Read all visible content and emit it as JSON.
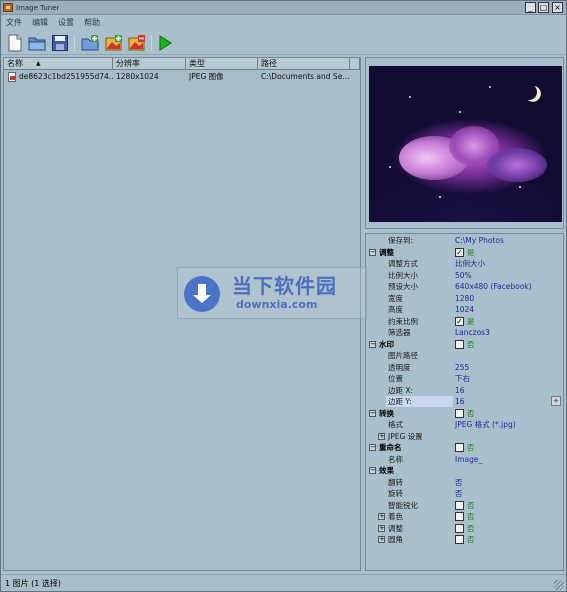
{
  "window": {
    "title": "Image Tuner",
    "controls": {
      "minimize": "_",
      "maximize": "□",
      "close": "×"
    }
  },
  "menu": [
    "文件",
    "编辑",
    "设置",
    "帮助"
  ],
  "toolbar": {
    "buttons": [
      "new-file-icon",
      "open-folder-icon",
      "save-icon",
      "add-folder-icon",
      "add-image-icon",
      "remove-image-icon",
      "run-icon"
    ]
  },
  "filelist": {
    "columns": [
      "名称",
      "分辨率",
      "类型",
      "路径"
    ],
    "sort_indicator": "▲",
    "rows": [
      {
        "name": "de8623c1bd251955d74...",
        "resolution": "1280x1024",
        "type": "JPEG 图像",
        "path": "C:\\Documents and Se..."
      }
    ]
  },
  "properties": {
    "save_to": {
      "label": "保存到:",
      "value": "C:\\My Photos"
    },
    "adjust": {
      "label": "调整",
      "checked": true,
      "check_text": "是",
      "items": [
        {
          "label": "调整方式",
          "value": "比例大小"
        },
        {
          "label": "比例大小",
          "value": "50%"
        },
        {
          "label": "预设大小",
          "value": "640x480 (Facebook)"
        },
        {
          "label": "宽度",
          "value": "1280"
        },
        {
          "label": "高度",
          "value": "1024"
        },
        {
          "label": "约束比例",
          "value": "是",
          "checkbox": true,
          "checked": true
        },
        {
          "label": "筛选器",
          "value": "Lanczos3"
        }
      ]
    },
    "watermark": {
      "label": "水印",
      "checked": false,
      "check_text": "否",
      "items": [
        {
          "label": "图片路径",
          "value": ""
        },
        {
          "label": "透明度",
          "value": "255"
        },
        {
          "label": "位置",
          "value": "下右"
        },
        {
          "label": "边距 X:",
          "value": "16"
        },
        {
          "label": "边距 Y:",
          "value": "16"
        }
      ]
    },
    "convert": {
      "label": "转换",
      "checked": false,
      "check_text": "否",
      "items": [
        {
          "label": "格式",
          "value": "JPEG 格式 (*.jpg)"
        },
        {
          "label": "JPEG 设置",
          "value": ""
        }
      ]
    },
    "rename": {
      "label": "重命名",
      "checked": false,
      "check_text": "否",
      "items": [
        {
          "label": "名称",
          "value": "Image_"
        }
      ]
    },
    "effects": {
      "label": "效果",
      "items": [
        {
          "label": "翻转",
          "value": "否"
        },
        {
          "label": "旋转",
          "value": "否"
        },
        {
          "label": "智能锐化",
          "value": "否",
          "checkbox": true,
          "checked": false
        },
        {
          "label": "着色",
          "value": "否",
          "checkbox": true,
          "checked": false
        },
        {
          "label": "调整",
          "value": "否",
          "checkbox": true,
          "checked": false
        },
        {
          "label": "圆角",
          "value": "否",
          "checkbox": true,
          "checked": false
        }
      ]
    },
    "spin_glyph": "÷"
  },
  "status": {
    "text": "1 图片 (1 选择)"
  },
  "watermark_overlay": {
    "title": "当下软件园",
    "subtitle": "downxia.com"
  },
  "colors": {
    "background": "#a9bfcb",
    "value_text": "#1b2d9a",
    "check_green": "#1f7a1f",
    "watermark_blue": "#4a70c2"
  }
}
